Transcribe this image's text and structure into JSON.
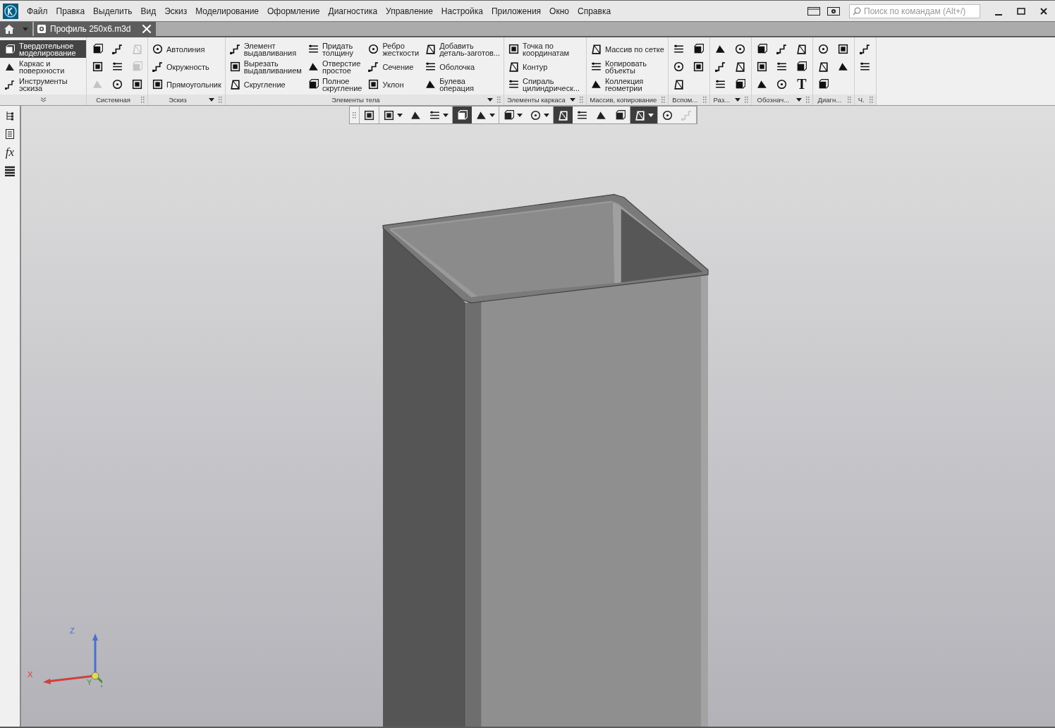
{
  "menu": [
    "Файл",
    "Правка",
    "Выделить",
    "Вид",
    "Эскиз",
    "Моделирование",
    "Оформление",
    "Диагностика",
    "Управление",
    "Настройка",
    "Приложения",
    "Окно",
    "Справка"
  ],
  "search": {
    "placeholder": "Поиск по командам (Alt+/)"
  },
  "tabs": [
    {
      "label": "Профиль 250x6.m3d",
      "selected": true
    }
  ],
  "modes": [
    {
      "label": "Твердотельное\nмоделирование",
      "selected": true
    },
    {
      "label": "Каркас и\nповерхности",
      "selected": false
    },
    {
      "label": "Инструменты\nэскиза",
      "selected": false
    }
  ],
  "groups": [
    {
      "title": "Системная",
      "dropdown": false,
      "items": [
        {
          "kind": "icon",
          "disabled": false
        },
        {
          "kind": "icon",
          "disabled": false
        },
        {
          "kind": "icon",
          "disabled": true
        },
        {
          "kind": "icon",
          "disabled": false
        },
        {
          "kind": "icon",
          "disabled": false
        },
        {
          "kind": "icon",
          "disabled": false
        },
        {
          "kind": "icon",
          "disabled": true
        },
        {
          "kind": "icon",
          "disabled": true
        },
        {
          "kind": "icon",
          "disabled": false
        }
      ]
    },
    {
      "title": "Эскиз",
      "dropdown": true,
      "items": [
        {
          "kind": "large",
          "label": "Автолиния"
        },
        {
          "kind": "large",
          "label": "Окружность"
        },
        {
          "kind": "large",
          "label": "Прямоугольник"
        }
      ]
    },
    {
      "title": "Элементы тела",
      "dropdown": true,
      "items": [
        {
          "kind": "large",
          "label": "Элемент\nвыдавливания"
        },
        {
          "kind": "large",
          "label": "Вырезать\nвыдавливанием"
        },
        {
          "kind": "large",
          "label": "Скругление"
        },
        {
          "kind": "large",
          "label": "Придать\nтолщину"
        },
        {
          "kind": "large",
          "label": "Отверстие\nпростое"
        },
        {
          "kind": "large",
          "label": "Полное\nскругление"
        },
        {
          "kind": "large",
          "label": "Ребро\nжесткости"
        },
        {
          "kind": "large",
          "label": "Сечение"
        },
        {
          "kind": "large",
          "label": "Уклон"
        },
        {
          "kind": "large",
          "label": "Добавить\nдеталь-заготов..."
        },
        {
          "kind": "large",
          "label": "Оболочка"
        },
        {
          "kind": "large",
          "label": "Булева\nоперация"
        }
      ]
    },
    {
      "title": "Элементы каркаса",
      "dropdown": true,
      "items": [
        {
          "kind": "large",
          "label": "Точка по\nкоординатам"
        },
        {
          "kind": "large",
          "label": "Контур"
        },
        {
          "kind": "large",
          "label": "Спираль\nцилиндрическ..."
        }
      ]
    },
    {
      "title": "Массив, копирование",
      "dropdown": false,
      "items": [
        {
          "kind": "large",
          "label": "Массив по сетке"
        },
        {
          "kind": "large",
          "label": "Копировать\nобъекты"
        },
        {
          "kind": "large",
          "label": "Коллекция\nгеометрии"
        }
      ]
    },
    {
      "title": "Вспом...",
      "dropdown": false,
      "items": [
        {
          "kind": "icon",
          "disabled": false
        },
        {
          "kind": "icon",
          "disabled": false
        },
        {
          "kind": "icon",
          "disabled": false
        },
        {
          "kind": "icon",
          "disabled": false
        },
        {
          "kind": "icon",
          "disabled": false
        }
      ]
    },
    {
      "title": "Раз...",
      "dropdown": true,
      "items": [
        {
          "kind": "icon",
          "disabled": false
        },
        {
          "kind": "icon",
          "disabled": false
        },
        {
          "kind": "icon",
          "disabled": false
        },
        {
          "kind": "icon",
          "disabled": false
        },
        {
          "kind": "icon",
          "disabled": false
        },
        {
          "kind": "icon",
          "disabled": false
        }
      ]
    },
    {
      "title": "Обознач...",
      "dropdown": true,
      "items": [
        {
          "kind": "icon",
          "disabled": false
        },
        {
          "kind": "icon",
          "disabled": false
        },
        {
          "kind": "icon",
          "disabled": false
        },
        {
          "kind": "icon",
          "disabled": false
        },
        {
          "kind": "icon",
          "disabled": false
        },
        {
          "kind": "icon",
          "disabled": false
        },
        {
          "kind": "icon",
          "disabled": false
        },
        {
          "kind": "icon",
          "disabled": false
        },
        {
          "kind": "large",
          "label": "T"
        }
      ]
    },
    {
      "title": "Диагн...",
      "dropdown": false,
      "items": [
        {
          "kind": "icon",
          "disabled": false
        },
        {
          "kind": "icon",
          "disabled": false
        },
        {
          "kind": "icon",
          "disabled": false
        },
        {
          "kind": "icon",
          "disabled": false
        },
        {
          "kind": "icon",
          "disabled": false
        }
      ]
    },
    {
      "title": "Ч.",
      "dropdown": false,
      "items": [
        {
          "kind": "icon",
          "disabled": false
        },
        {
          "kind": "icon",
          "disabled": false
        }
      ]
    }
  ],
  "side_panel": {
    "formula_label": "fx"
  },
  "view_toolbar": [
    [
      {
        "kind": "button",
        "on": false,
        "disabled": false
      }
    ],
    [
      {
        "kind": "dropdown",
        "on": false,
        "disabled": false
      },
      {
        "kind": "button",
        "on": false,
        "disabled": false
      },
      {
        "kind": "dropdown",
        "on": false,
        "disabled": false
      }
    ],
    [
      {
        "kind": "button",
        "on": true,
        "disabled": false
      },
      {
        "kind": "dropdown",
        "on": false,
        "disabled": false
      }
    ],
    [
      {
        "kind": "dropdown",
        "on": false,
        "disabled": false
      },
      {
        "kind": "dropdown",
        "on": false,
        "disabled": false
      }
    ],
    [
      {
        "kind": "button",
        "on": true,
        "disabled": false
      },
      {
        "kind": "button",
        "on": false,
        "disabled": false
      },
      {
        "kind": "button",
        "on": false,
        "disabled": false
      },
      {
        "kind": "button",
        "on": false,
        "disabled": false
      }
    ],
    [
      {
        "kind": "dropdown",
        "on": true,
        "disabled": false
      }
    ],
    [
      {
        "kind": "button",
        "on": false,
        "disabled": false
      },
      {
        "kind": "button",
        "on": false,
        "disabled": true
      }
    ]
  ],
  "axes": {
    "x": "X",
    "y": "Y",
    "z": "Z"
  }
}
